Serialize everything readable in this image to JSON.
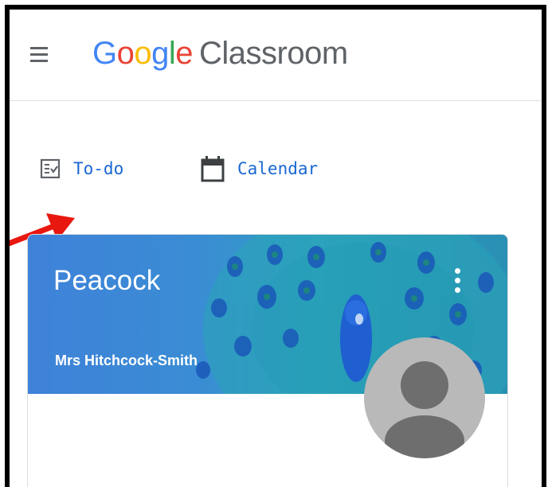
{
  "header": {
    "logo_google": [
      "G",
      "o",
      "o",
      "g",
      "l",
      "e"
    ],
    "product_name": "Classroom"
  },
  "nav": {
    "todo_label": "To-do",
    "calendar_label": "Calendar"
  },
  "card": {
    "class_name": "Peacock",
    "teacher_name": "Mrs Hitchcock-Smith"
  },
  "colors": {
    "link_blue": "#1967d2",
    "header_blue": "#3b86d8",
    "annotation_arrow": "#e8170f"
  },
  "icons": {
    "menu": "hamburger-menu-icon",
    "todo": "todo-checklist-icon",
    "calendar": "calendar-icon",
    "more": "more-vert-icon",
    "avatar": "person-avatar-icon"
  }
}
